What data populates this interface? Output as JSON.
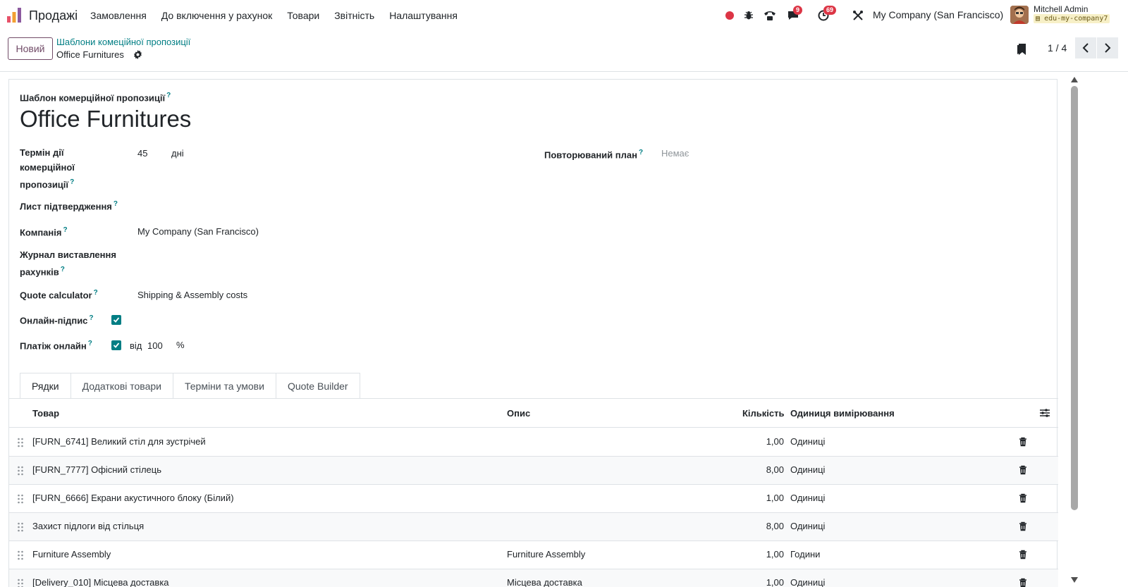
{
  "navbar": {
    "app_name": "Продажі",
    "menu": [
      "Замовлення",
      "До включення у рахунок",
      "Товари",
      "Звітність",
      "Налаштування"
    ],
    "messages_count": "9",
    "activities_count": "69",
    "company": "My Company (San Francisco)",
    "user_name": "Mitchell Admin",
    "database": "edu-my-company7"
  },
  "control_panel": {
    "new_button": "Новий",
    "breadcrumb_parent": "Шаблони комеційної пропозиції",
    "breadcrumb_current": "Office Furnitures",
    "pager": "1 / 4"
  },
  "form": {
    "title_label": "Шаблон комерційної пропозиції",
    "title": "Office Furnitures",
    "validity_label_1": "Термін дії",
    "validity_label_2": "комерційної",
    "validity_label_3": "пропозиції",
    "validity_value": "45",
    "validity_unit": "дні",
    "recurring_label": "Повторюваний план",
    "recurring_placeholder": "Немає",
    "confirmation_label": "Лист підтвердження",
    "company_label": "Компанія",
    "company_value": "My Company (San Francisco)",
    "journal_label_1": "Журнал виставлення",
    "journal_label_2": "рахунків",
    "calculator_label": "Quote calculator",
    "calculator_value": "Shipping & Assembly costs",
    "signature_label": "Онлайн-підпис",
    "signature_checked": true,
    "payment_label": "Платіж онлайн",
    "payment_checked": true,
    "payment_prefix": "від",
    "payment_value": "100",
    "payment_unit": "%"
  },
  "tabs": [
    "Рядки",
    "Додаткові товари",
    "Терміни та умови",
    "Quote Builder"
  ],
  "table": {
    "headers": {
      "product": "Товар",
      "description": "Опис",
      "quantity": "Кількість",
      "uom": "Одиниця вимірювання"
    },
    "rows": [
      {
        "product": "[FURN_6741] Великий стіл для зустрічей",
        "description": "",
        "quantity": "1,00",
        "uom": "Одиниці"
      },
      {
        "product": "[FURN_7777] Офісний стілець",
        "description": "",
        "quantity": "8,00",
        "uom": "Одиниці"
      },
      {
        "product": "[FURN_6666] Екрани акустичного блоку (Білий)",
        "description": "",
        "quantity": "1,00",
        "uom": "Одиниці"
      },
      {
        "product": "Захист підлоги від стільця",
        "description": "",
        "quantity": "8,00",
        "uom": "Одиниці"
      },
      {
        "product": "Furniture Assembly",
        "description": "Furniture Assembly",
        "quantity": "1,00",
        "uom": "Години"
      },
      {
        "product": "[Delivery_010] Місцева доставка",
        "description": "Місцева доставка",
        "quantity": "1,00",
        "uom": "Одиниці"
      }
    ]
  },
  "colors": {
    "brand": "#714b67",
    "accent": "#017e84",
    "badge": "#dc3545"
  }
}
